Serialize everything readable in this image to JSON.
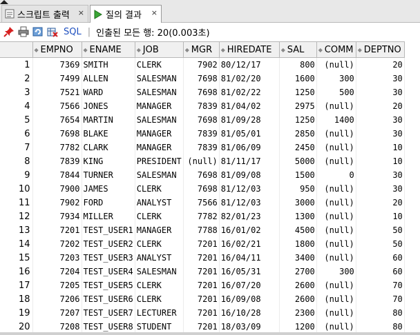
{
  "tabs": [
    {
      "label": "스크립트 출력",
      "close": "×",
      "icon": "script-output-icon"
    },
    {
      "label": "질의 결과",
      "close": "×",
      "icon": "run-triangle-icon"
    }
  ],
  "toolbar": {
    "sql_label": "SQL",
    "separator": "|",
    "status": "인출된 모든 행: 20(0.003초)",
    "icons": [
      "pin-icon",
      "print-icon",
      "refresh-icon",
      "export-icon"
    ]
  },
  "grid": {
    "columns": [
      "EMPNO",
      "ENAME",
      "JOB",
      "MGR",
      "HIREDATE",
      "SAL",
      "COMM",
      "DEPTNO"
    ],
    "rows": [
      [
        "1",
        "7369",
        "SMITH",
        "CLERK",
        "7902",
        "80/12/17",
        "800",
        "(null)",
        "20"
      ],
      [
        "2",
        "7499",
        "ALLEN",
        "SALESMAN",
        "7698",
        "81/02/20",
        "1600",
        "300",
        "30"
      ],
      [
        "3",
        "7521",
        "WARD",
        "SALESMAN",
        "7698",
        "81/02/22",
        "1250",
        "500",
        "30"
      ],
      [
        "4",
        "7566",
        "JONES",
        "MANAGER",
        "7839",
        "81/04/02",
        "2975",
        "(null)",
        "20"
      ],
      [
        "5",
        "7654",
        "MARTIN",
        "SALESMAN",
        "7698",
        "81/09/28",
        "1250",
        "1400",
        "30"
      ],
      [
        "6",
        "7698",
        "BLAKE",
        "MANAGER",
        "7839",
        "81/05/01",
        "2850",
        "(null)",
        "30"
      ],
      [
        "7",
        "7782",
        "CLARK",
        "MANAGER",
        "7839",
        "81/06/09",
        "2450",
        "(null)",
        "10"
      ],
      [
        "8",
        "7839",
        "KING",
        "PRESIDENT",
        "(null)",
        "81/11/17",
        "5000",
        "(null)",
        "10"
      ],
      [
        "9",
        "7844",
        "TURNER",
        "SALESMAN",
        "7698",
        "81/09/08",
        "1500",
        "0",
        "30"
      ],
      [
        "10",
        "7900",
        "JAMES",
        "CLERK",
        "7698",
        "81/12/03",
        "950",
        "(null)",
        "30"
      ],
      [
        "11",
        "7902",
        "FORD",
        "ANALYST",
        "7566",
        "81/12/03",
        "3000",
        "(null)",
        "20"
      ],
      [
        "12",
        "7934",
        "MILLER",
        "CLERK",
        "7782",
        "82/01/23",
        "1300",
        "(null)",
        "10"
      ],
      [
        "13",
        "7201",
        "TEST_USER1",
        "MANAGER",
        "7788",
        "16/01/02",
        "4500",
        "(null)",
        "50"
      ],
      [
        "14",
        "7202",
        "TEST_USER2",
        "CLERK",
        "7201",
        "16/02/21",
        "1800",
        "(null)",
        "50"
      ],
      [
        "15",
        "7203",
        "TEST_USER3",
        "ANALYST",
        "7201",
        "16/04/11",
        "3400",
        "(null)",
        "60"
      ],
      [
        "16",
        "7204",
        "TEST_USER4",
        "SALESMAN",
        "7201",
        "16/05/31",
        "2700",
        "300",
        "60"
      ],
      [
        "17",
        "7205",
        "TEST_USER5",
        "CLERK",
        "7201",
        "16/07/20",
        "2600",
        "(null)",
        "70"
      ],
      [
        "18",
        "7206",
        "TEST_USER6",
        "CLERK",
        "7201",
        "16/09/08",
        "2600",
        "(null)",
        "70"
      ],
      [
        "19",
        "7207",
        "TEST_USER7",
        "LECTURER",
        "7201",
        "16/10/28",
        "2300",
        "(null)",
        "80"
      ],
      [
        "20",
        "7208",
        "TEST_USER8",
        "STUDENT",
        "7201",
        "18/03/09",
        "1200",
        "(null)",
        "80"
      ]
    ]
  }
}
